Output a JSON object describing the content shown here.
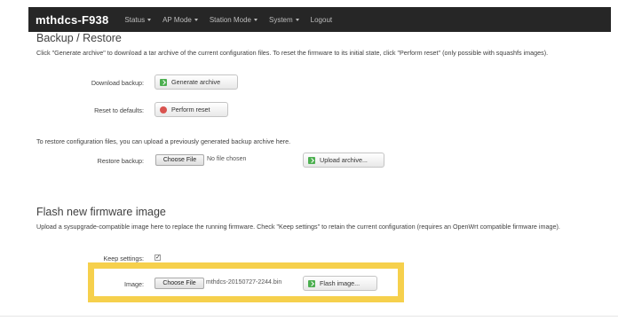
{
  "nav": {
    "brand": "mthdcs-F938",
    "items": [
      {
        "label": "Status",
        "dropdown": true
      },
      {
        "label": "AP Mode",
        "dropdown": true
      },
      {
        "label": "Station Mode",
        "dropdown": true
      },
      {
        "label": "System",
        "dropdown": true
      },
      {
        "label": "Logout",
        "dropdown": false
      }
    ]
  },
  "backup": {
    "title": "Backup / Restore",
    "description": "Click \"Generate archive\" to download a tar archive of the current configuration files. To reset the firmware to its initial state, click \"Perform reset\" (only possible with squashfs images).",
    "download_label": "Download backup:",
    "generate_button": "Generate archive",
    "reset_label": "Reset to defaults:",
    "reset_button": "Perform reset",
    "restore_description": "To restore configuration files, you can upload a previously generated backup archive here.",
    "restore_label": "Restore backup:",
    "choose_file": "Choose File",
    "no_file": "No file chosen",
    "upload_button": "Upload archive..."
  },
  "flash": {
    "title": "Flash new firmware image",
    "description": "Upload a sysupgrade-compatible image here to replace the running firmware. Check \"Keep settings\" to retain the current configuration (requires an OpenWrt compatible firmware image).",
    "keep_label": "Keep settings:",
    "keep_checked": true,
    "image_label": "Image:",
    "choose_file": "Choose File",
    "file_name": "mthdcs-20150727-2244.bin",
    "flash_button": "Flash image..."
  },
  "colors": {
    "navbar": "#262626",
    "highlight": "#f6d04c",
    "accent_green": "#4caf50",
    "accent_red": "#d9534f"
  }
}
